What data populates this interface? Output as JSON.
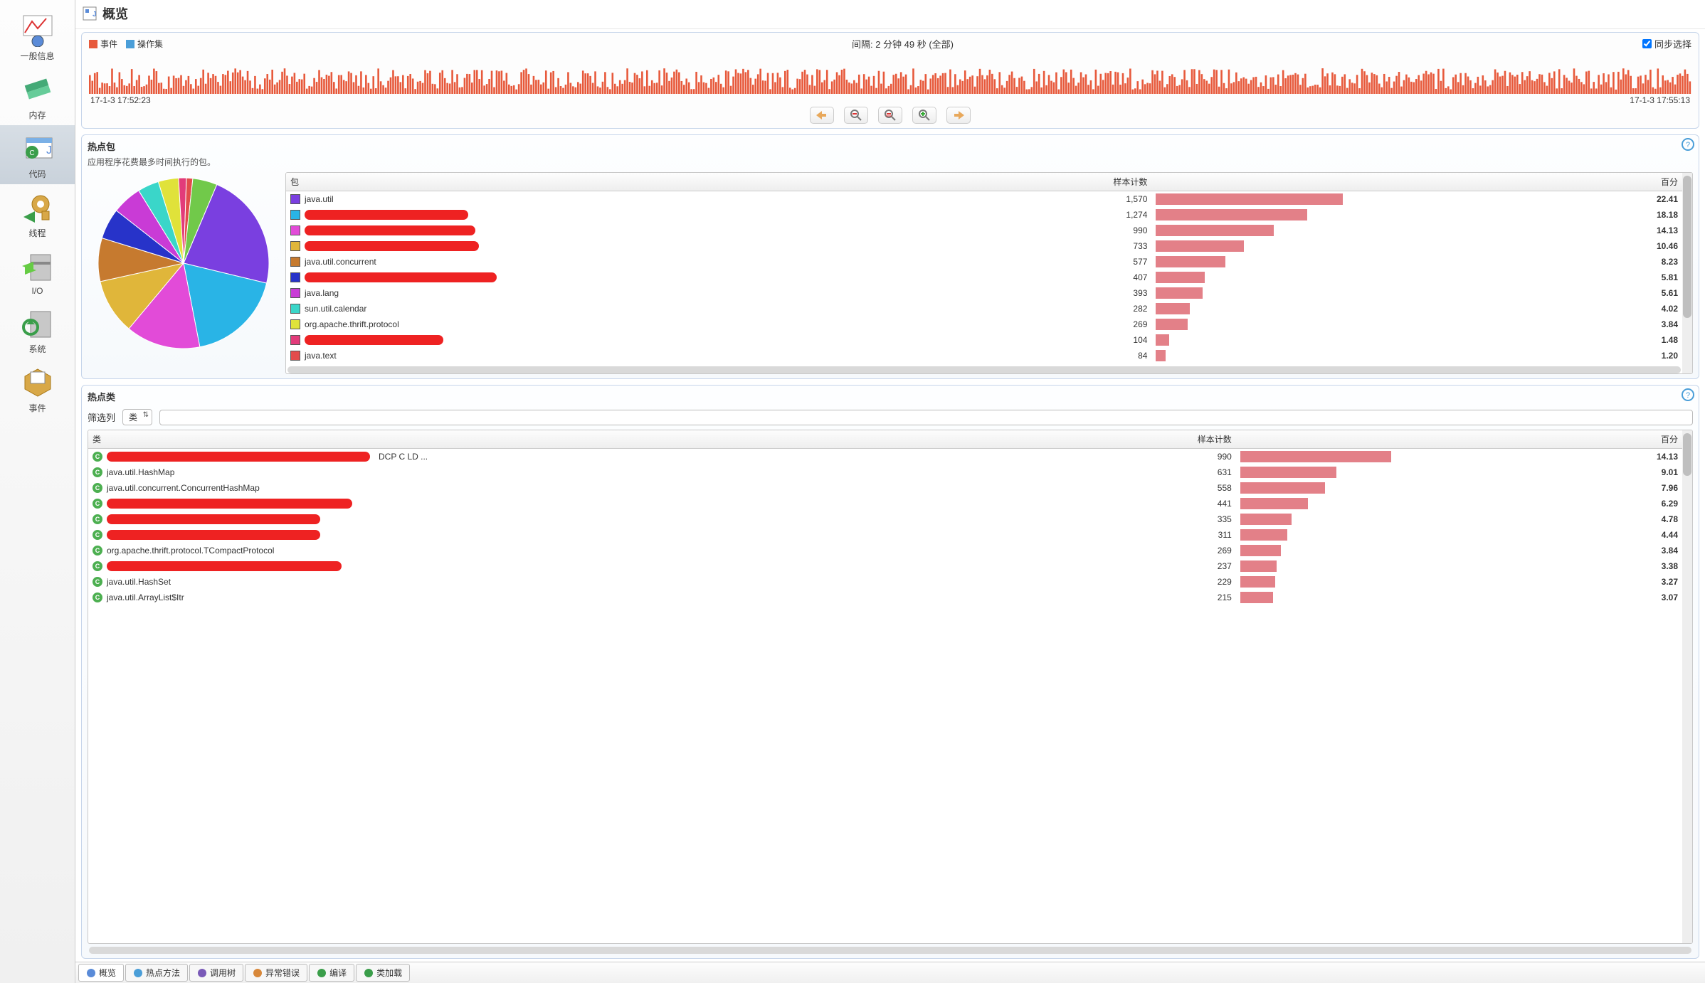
{
  "sidebar": {
    "items": [
      {
        "key": "general",
        "label": "一般信息"
      },
      {
        "key": "memory",
        "label": "内存"
      },
      {
        "key": "code",
        "label": "代码"
      },
      {
        "key": "threads",
        "label": "线程"
      },
      {
        "key": "io",
        "label": "I/O"
      },
      {
        "key": "system",
        "label": "系统"
      },
      {
        "key": "events",
        "label": "事件"
      }
    ]
  },
  "page": {
    "title": "概览"
  },
  "timeline": {
    "legend": {
      "events": "事件",
      "ops": "操作集"
    },
    "interval": "间隔: 2 分钟 49 秒 (全部)",
    "sync": "同步选择",
    "start": "17-1-3 17:52:23",
    "end": "17-1-3 17:55:13"
  },
  "hotpkg": {
    "title": "热点包",
    "subtitle": "应用程序花费最多时间执行的包。",
    "columns": {
      "pkg": "包",
      "samples": "样本计数",
      "pct": "百分"
    },
    "rows": [
      {
        "color": "#7a3fe0",
        "name": "java.util",
        "samples": "1,570",
        "pct": "22.41",
        "bar": 100,
        "redacted": false
      },
      {
        "color": "#29b4e6",
        "name": "",
        "samples": "1,274",
        "pct": "18.18",
        "bar": 81,
        "redacted": true,
        "rw": 230
      },
      {
        "color": "#e24bd8",
        "name": "",
        "samples": "990",
        "pct": "14.13",
        "bar": 63,
        "redacted": true,
        "rw": 240
      },
      {
        "color": "#e0b63a",
        "name": "",
        "samples": "733",
        "pct": "10.46",
        "bar": 47,
        "redacted": true,
        "rw": 245
      },
      {
        "color": "#c67a2f",
        "name": "java.util.concurrent",
        "samples": "577",
        "pct": "8.23",
        "bar": 37,
        "redacted": false
      },
      {
        "color": "#2733c9",
        "name": "",
        "samples": "407",
        "pct": "5.81",
        "bar": 26,
        "redacted": true,
        "rw": 270
      },
      {
        "color": "#c93bd6",
        "name": "java.lang",
        "samples": "393",
        "pct": "5.61",
        "bar": 25,
        "redacted": false
      },
      {
        "color": "#3ad6c9",
        "name": "sun.util.calendar",
        "samples": "282",
        "pct": "4.02",
        "bar": 18,
        "redacted": false
      },
      {
        "color": "#e0e23a",
        "name": "org.apache.thrift.protocol",
        "samples": "269",
        "pct": "3.84",
        "bar": 17,
        "redacted": false
      },
      {
        "color": "#e23b7a",
        "name": "",
        "samples": "104",
        "pct": "1.48",
        "bar": 7,
        "redacted": true,
        "rw": 195
      },
      {
        "color": "#e24b4b",
        "name": "java.text",
        "samples": "84",
        "pct": "1.20",
        "bar": 5,
        "redacted": false
      }
    ]
  },
  "chart_data": {
    "type": "pie",
    "title": "热点包",
    "series": [
      {
        "name": "java.util",
        "value": 1570,
        "color": "#7a3fe0"
      },
      {
        "name": "(redacted)",
        "value": 1274,
        "color": "#29b4e6"
      },
      {
        "name": "(redacted)",
        "value": 990,
        "color": "#e24bd8"
      },
      {
        "name": "(redacted)",
        "value": 733,
        "color": "#e0b63a"
      },
      {
        "name": "java.util.concurrent",
        "value": 577,
        "color": "#c67a2f"
      },
      {
        "name": "(redacted)",
        "value": 407,
        "color": "#2733c9"
      },
      {
        "name": "java.lang",
        "value": 393,
        "color": "#c93bd6"
      },
      {
        "name": "sun.util.calendar",
        "value": 282,
        "color": "#3ad6c9"
      },
      {
        "name": "org.apache.thrift.protocol",
        "value": 269,
        "color": "#e0e23a"
      },
      {
        "name": "(redacted)",
        "value": 104,
        "color": "#e23b7a"
      },
      {
        "name": "java.text",
        "value": 84,
        "color": "#e24b4b"
      },
      {
        "name": "other",
        "value": 325,
        "color": "#71c94a"
      }
    ]
  },
  "hotclass": {
    "title": "热点类",
    "filter_label": "筛选列",
    "filter_select": "类",
    "columns": {
      "cls": "类",
      "samples": "样本计数",
      "pct": "百分"
    },
    "rows": [
      {
        "name": "",
        "samples": "990",
        "pct": "14.13",
        "bar": 100,
        "redacted": true,
        "rw": 370,
        "suffix": "DCP      C       LD ..."
      },
      {
        "name": "java.util.HashMap",
        "samples": "631",
        "pct": "9.01",
        "bar": 64,
        "redacted": false
      },
      {
        "name": "java.util.concurrent.ConcurrentHashMap",
        "samples": "558",
        "pct": "7.96",
        "bar": 56,
        "redacted": false
      },
      {
        "name": "",
        "samples": "441",
        "pct": "6.29",
        "bar": 45,
        "redacted": true,
        "rw": 345
      },
      {
        "name": "",
        "samples": "335",
        "pct": "4.78",
        "bar": 34,
        "redacted": true,
        "rw": 300
      },
      {
        "name": "",
        "samples": "311",
        "pct": "4.44",
        "bar": 31,
        "redacted": true,
        "rw": 300
      },
      {
        "name": "org.apache.thrift.protocol.TCompactProtocol",
        "samples": "269",
        "pct": "3.84",
        "bar": 27,
        "redacted": false
      },
      {
        "name": "",
        "samples": "237",
        "pct": "3.38",
        "bar": 24,
        "redacted": true,
        "rw": 330
      },
      {
        "name": "java.util.HashSet",
        "samples": "229",
        "pct": "3.27",
        "bar": 23,
        "redacted": false
      },
      {
        "name": "java.util.ArrayList$Itr",
        "samples": "215",
        "pct": "3.07",
        "bar": 22,
        "redacted": false
      }
    ]
  },
  "tabs": [
    {
      "key": "overview",
      "label": "概览",
      "active": true
    },
    {
      "key": "hotmethods",
      "label": "热点方法"
    },
    {
      "key": "calltree",
      "label": "调用树"
    },
    {
      "key": "exceptions",
      "label": "异常错误"
    },
    {
      "key": "compile",
      "label": "编译"
    },
    {
      "key": "classload",
      "label": "类加载"
    }
  ]
}
